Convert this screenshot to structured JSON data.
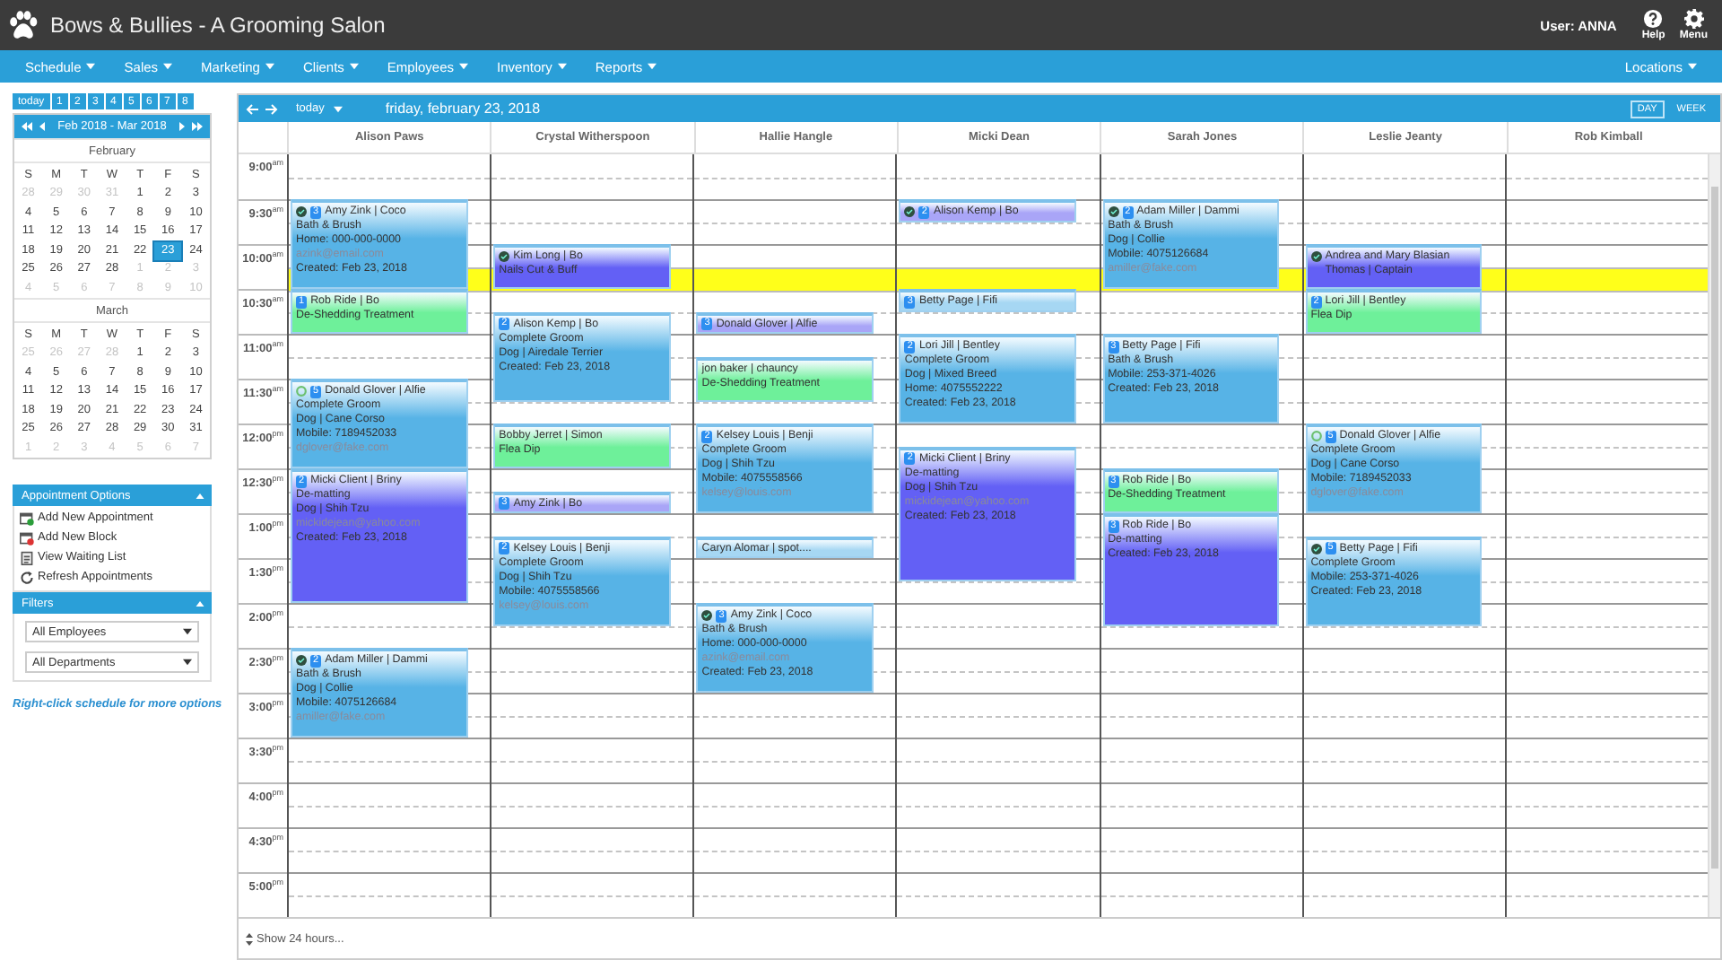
{
  "header": {
    "title": "Bows & Bullies - A Grooming Salon",
    "user": "User: ANNA",
    "actions": [
      {
        "label": "Help",
        "kind": "help"
      },
      {
        "label": "Menu",
        "kind": "settings"
      }
    ]
  },
  "nav": {
    "items": [
      "Schedule",
      "Sales",
      "Marketing",
      "Clients",
      "Employees",
      "Inventory",
      "Reports"
    ],
    "right": "Locations"
  },
  "sidebar": {
    "quick": [
      "today",
      "1",
      "2",
      "3",
      "4",
      "5",
      "6",
      "7",
      "8"
    ],
    "range": "Feb 2018 - Mar 2018",
    "months": [
      {
        "name": "February",
        "weekdays": [
          "S",
          "M",
          "T",
          "W",
          "T",
          "F",
          "S"
        ],
        "weeks": [
          [
            {
              "day": "28",
              "muted": true,
              "selected": false
            },
            {
              "day": "29",
              "muted": true,
              "selected": false
            },
            {
              "day": "30",
              "muted": true,
              "selected": false
            },
            {
              "day": "31",
              "muted": true,
              "selected": false
            },
            {
              "day": "1",
              "muted": false,
              "selected": false
            },
            {
              "day": "2",
              "muted": false,
              "selected": false
            },
            {
              "day": "3",
              "muted": false,
              "selected": false
            }
          ],
          [
            {
              "day": "4",
              "muted": false,
              "selected": false
            },
            {
              "day": "5",
              "muted": false,
              "selected": false
            },
            {
              "day": "6",
              "muted": false,
              "selected": false
            },
            {
              "day": "7",
              "muted": false,
              "selected": false
            },
            {
              "day": "8",
              "muted": false,
              "selected": false
            },
            {
              "day": "9",
              "muted": false,
              "selected": false
            },
            {
              "day": "10",
              "muted": false,
              "selected": false
            }
          ],
          [
            {
              "day": "11",
              "muted": false,
              "selected": false
            },
            {
              "day": "12",
              "muted": false,
              "selected": false
            },
            {
              "day": "13",
              "muted": false,
              "selected": false
            },
            {
              "day": "14",
              "muted": false,
              "selected": false
            },
            {
              "day": "15",
              "muted": false,
              "selected": false
            },
            {
              "day": "16",
              "muted": false,
              "selected": false
            },
            {
              "day": "17",
              "muted": false,
              "selected": false
            }
          ],
          [
            {
              "day": "18",
              "muted": false,
              "selected": false
            },
            {
              "day": "19",
              "muted": false,
              "selected": false
            },
            {
              "day": "20",
              "muted": false,
              "selected": false
            },
            {
              "day": "21",
              "muted": false,
              "selected": false
            },
            {
              "day": "22",
              "muted": false,
              "selected": false
            },
            {
              "day": "23",
              "muted": false,
              "selected": true
            },
            {
              "day": "24",
              "muted": false,
              "selected": false
            }
          ],
          [
            {
              "day": "25",
              "muted": false,
              "selected": false
            },
            {
              "day": "26",
              "muted": false,
              "selected": false
            },
            {
              "day": "27",
              "muted": false,
              "selected": false
            },
            {
              "day": "28",
              "muted": false,
              "selected": false
            },
            {
              "day": "1",
              "muted": true,
              "selected": false
            },
            {
              "day": "2",
              "muted": true,
              "selected": false
            },
            {
              "day": "3",
              "muted": true,
              "selected": false
            }
          ],
          [
            {
              "day": "4",
              "muted": true,
              "selected": false
            },
            {
              "day": "5",
              "muted": true,
              "selected": false
            },
            {
              "day": "6",
              "muted": true,
              "selected": false
            },
            {
              "day": "7",
              "muted": true,
              "selected": false
            },
            {
              "day": "8",
              "muted": true,
              "selected": false
            },
            {
              "day": "9",
              "muted": true,
              "selected": false
            },
            {
              "day": "10",
              "muted": true,
              "selected": false
            }
          ]
        ]
      },
      {
        "name": "March",
        "weekdays": [
          "S",
          "M",
          "T",
          "W",
          "T",
          "F",
          "S"
        ],
        "weeks": [
          [
            {
              "day": "25",
              "muted": true,
              "selected": false
            },
            {
              "day": "26",
              "muted": true,
              "selected": false
            },
            {
              "day": "27",
              "muted": true,
              "selected": false
            },
            {
              "day": "28",
              "muted": true,
              "selected": false
            },
            {
              "day": "1",
              "muted": false,
              "selected": false
            },
            {
              "day": "2",
              "muted": false,
              "selected": false
            },
            {
              "day": "3",
              "muted": false,
              "selected": false
            }
          ],
          [
            {
              "day": "4",
              "muted": false,
              "selected": false
            },
            {
              "day": "5",
              "muted": false,
              "selected": false
            },
            {
              "day": "6",
              "muted": false,
              "selected": false
            },
            {
              "day": "7",
              "muted": false,
              "selected": false
            },
            {
              "day": "8",
              "muted": false,
              "selected": false
            },
            {
              "day": "9",
              "muted": false,
              "selected": false
            },
            {
              "day": "10",
              "muted": false,
              "selected": false
            }
          ],
          [
            {
              "day": "11",
              "muted": false,
              "selected": false
            },
            {
              "day": "12",
              "muted": false,
              "selected": false
            },
            {
              "day": "13",
              "muted": false,
              "selected": false
            },
            {
              "day": "14",
              "muted": false,
              "selected": false
            },
            {
              "day": "15",
              "muted": false,
              "selected": false
            },
            {
              "day": "16",
              "muted": false,
              "selected": false
            },
            {
              "day": "17",
              "muted": false,
              "selected": false
            }
          ],
          [
            {
              "day": "18",
              "muted": false,
              "selected": false
            },
            {
              "day": "19",
              "muted": false,
              "selected": false
            },
            {
              "day": "20",
              "muted": false,
              "selected": false
            },
            {
              "day": "21",
              "muted": false,
              "selected": false
            },
            {
              "day": "22",
              "muted": false,
              "selected": false
            },
            {
              "day": "23",
              "muted": false,
              "selected": false
            },
            {
              "day": "24",
              "muted": false,
              "selected": false
            }
          ],
          [
            {
              "day": "25",
              "muted": false,
              "selected": false
            },
            {
              "day": "26",
              "muted": false,
              "selected": false
            },
            {
              "day": "27",
              "muted": false,
              "selected": false
            },
            {
              "day": "28",
              "muted": false,
              "selected": false
            },
            {
              "day": "29",
              "muted": false,
              "selected": false
            },
            {
              "day": "30",
              "muted": false,
              "selected": false
            },
            {
              "day": "31",
              "muted": false,
              "selected": false
            }
          ],
          [
            {
              "day": "1",
              "muted": true,
              "selected": false
            },
            {
              "day": "2",
              "muted": true,
              "selected": false
            },
            {
              "day": "3",
              "muted": true,
              "selected": false
            },
            {
              "day": "4",
              "muted": true,
              "selected": false
            },
            {
              "day": "5",
              "muted": true,
              "selected": false
            },
            {
              "day": "6",
              "muted": true,
              "selected": false
            },
            {
              "day": "7",
              "muted": true,
              "selected": false
            }
          ]
        ]
      }
    ],
    "appointment_options": {
      "title": "Appointment Options",
      "items": [
        {
          "label": "Add New Appointment",
          "kind": "add"
        },
        {
          "label": "Add New Block",
          "kind": "block"
        },
        {
          "label": "View Waiting List",
          "kind": "list"
        },
        {
          "label": "Refresh Appointments",
          "kind": "refresh"
        }
      ]
    },
    "filters": {
      "title": "Filters",
      "selects": [
        {
          "value": "All Employees"
        },
        {
          "value": "All Departments"
        }
      ]
    },
    "hint": "Right-click schedule for more options"
  },
  "schedule": {
    "today": "today",
    "date": "friday, february 23, 2018",
    "views": [
      {
        "label": "DAY",
        "selected": true
      },
      {
        "label": "WEEK",
        "selected": false
      }
    ],
    "times": [
      {
        "time": "9:00",
        "period": "am"
      },
      {
        "time": "9:30",
        "period": "am"
      },
      {
        "time": "10:00",
        "period": "am"
      },
      {
        "time": "10:30",
        "period": "am"
      },
      {
        "time": "11:00",
        "period": "am"
      },
      {
        "time": "11:30",
        "period": "am"
      },
      {
        "time": "12:00",
        "period": "pm"
      },
      {
        "time": "12:30",
        "period": "pm"
      },
      {
        "time": "1:00",
        "period": "pm"
      },
      {
        "time": "1:30",
        "period": "pm"
      },
      {
        "time": "2:00",
        "period": "pm"
      },
      {
        "time": "2:30",
        "period": "pm"
      },
      {
        "time": "3:00",
        "period": "pm"
      },
      {
        "time": "3:30",
        "period": "pm"
      },
      {
        "time": "4:00",
        "period": "pm"
      },
      {
        "time": "4:30",
        "period": "pm"
      },
      {
        "time": "5:00",
        "period": "pm"
      }
    ],
    "columns": [
      {
        "name": "Alison Paws",
        "appointments": [
          {
            "color": "#57b3e6",
            "kind": "confirmed",
            "badge": "3",
            "title": "Amy Zink | Coco",
            "lines": [
              {
                "text": "Bath & Brush",
                "kind": "text"
              },
              {
                "text": "Home: 000-000-0000",
                "kind": "text"
              },
              {
                "text": "azink@email.com",
                "kind": "email"
              },
              {
                "text": "Created: Feb 23, 2018",
                "kind": "text"
              }
            ]
          },
          {
            "color": "#6ef09a",
            "kind": "plain",
            "badge": "1",
            "title": "Rob Ride | Bo",
            "lines": [
              {
                "text": "De-Shedding Treatment",
                "kind": "text"
              }
            ]
          },
          {
            "color": "#57b3e6",
            "kind": "recurring",
            "badge": "5",
            "title": "Donald Glover | Alfie",
            "lines": [
              {
                "text": "Complete Groom",
                "kind": "text"
              },
              {
                "text": "Dog | Cane Corso",
                "kind": "text"
              },
              {
                "text": "Mobile: 7189452033",
                "kind": "text"
              },
              {
                "text": "dglover@fake.com",
                "kind": "email"
              }
            ]
          },
          {
            "color": "#6360f5",
            "kind": "plain",
            "badge": "2",
            "title": "Micki Client | Briny",
            "lines": [
              {
                "text": "De-matting",
                "kind": "text"
              },
              {
                "text": "Dog | Shih Tzu",
                "kind": "text"
              },
              {
                "text": "mickidejean@yahoo.com",
                "kind": "email"
              },
              {
                "text": "Created: Feb 23, 2018",
                "kind": "text"
              }
            ]
          },
          {
            "color": "#57b3e6",
            "kind": "confirmed",
            "badge": "2",
            "title": "Adam Miller | Dammi",
            "lines": [
              {
                "text": "Bath & Brush",
                "kind": "text"
              },
              {
                "text": "Dog | Collie",
                "kind": "text"
              },
              {
                "text": "Mobile: 4075126684",
                "kind": "text"
              },
              {
                "text": "amiller@fake.com",
                "kind": "email"
              }
            ]
          }
        ]
      },
      {
        "name": "Crystal Witherspoon",
        "appointments": [
          {
            "color": "#6360f5",
            "kind": "confirmed",
            "title": "Kim Long | Bo",
            "lines": [
              {
                "text": "Nails Cut & Buff",
                "kind": "text"
              }
            ]
          },
          {
            "color": "#57b3e6",
            "kind": "plain",
            "badge": "2",
            "title": "Alison Kemp | Bo",
            "lines": [
              {
                "text": "Complete Groom",
                "kind": "text"
              },
              {
                "text": "Dog | Airedale Terrier",
                "kind": "text"
              },
              {
                "text": "Created: Feb 23, 2018",
                "kind": "text"
              }
            ]
          },
          {
            "color": "#6ef09a",
            "kind": "plain",
            "title": "Bobby Jerret | Simon",
            "lines": [
              {
                "text": "Flea Dip",
                "kind": "text"
              }
            ]
          },
          {
            "color": "#a9a5f7",
            "kind": "plain",
            "badge": "3",
            "title": "Amy Zink | Bo"
          },
          {
            "color": "#57b3e6",
            "kind": "plain",
            "badge": "2",
            "title": "Kelsey Louis | Benji",
            "lines": [
              {
                "text": "Complete Groom",
                "kind": "text"
              },
              {
                "text": "Dog | Shih Tzu",
                "kind": "text"
              },
              {
                "text": "Mobile: 4075558566",
                "kind": "text"
              },
              {
                "text": "kelsey@louis.com",
                "kind": "email"
              }
            ]
          }
        ]
      },
      {
        "name": "Hallie Hangle",
        "appointments": [
          {
            "color": "#a9a5f7",
            "kind": "plain",
            "badge": "3",
            "title": "Donald Glover | Alfie"
          },
          {
            "color": "#6ef09a",
            "kind": "plain",
            "title": "jon baker | chauncy",
            "lines": [
              {
                "text": "De-Shedding Treatment",
                "kind": "text"
              }
            ]
          },
          {
            "color": "#57b3e6",
            "kind": "plain",
            "badge": "2",
            "title": "Kelsey Louis | Benji",
            "lines": [
              {
                "text": "Complete Groom",
                "kind": "text"
              },
              {
                "text": "Dog | Shih Tzu",
                "kind": "text"
              },
              {
                "text": "Mobile: 4075558566",
                "kind": "text"
              },
              {
                "text": "kelsey@louis.com",
                "kind": "email"
              }
            ]
          },
          {
            "color": "#a6d7f3",
            "kind": "plain",
            "title": "Caryn Alomar | spot...."
          },
          {
            "color": "#57b3e6",
            "kind": "confirmed",
            "badge": "3",
            "title": "Amy Zink | Coco",
            "lines": [
              {
                "text": "Bath & Brush",
                "kind": "text"
              },
              {
                "text": "Home: 000-000-0000",
                "kind": "text"
              },
              {
                "text": "azink@email.com",
                "kind": "email"
              },
              {
                "text": "Created: Feb 23, 2018",
                "kind": "text"
              }
            ]
          }
        ]
      },
      {
        "name": "Micki Dean",
        "appointments": [
          {
            "color": "#a9a5f7",
            "kind": "confirmed",
            "badge": "2",
            "title": "Alison Kemp | Bo"
          },
          {
            "color": "#a6d7f3",
            "kind": "plain",
            "badge": "3",
            "title": "Betty Page | Fifi"
          },
          {
            "color": "#57b3e6",
            "kind": "plain",
            "badge": "2",
            "title": "Lori Jill | Bentley",
            "lines": [
              {
                "text": "Complete Groom",
                "kind": "text"
              },
              {
                "text": "Dog | Mixed Breed",
                "kind": "text"
              },
              {
                "text": "Home: 4075552222",
                "kind": "text"
              },
              {
                "text": "Created: Feb 23, 2018",
                "kind": "text"
              }
            ]
          },
          {
            "color": "#6360f5",
            "kind": "plain",
            "badge": "2",
            "title": "Micki Client | Briny",
            "lines": [
              {
                "text": "De-matting",
                "kind": "text"
              },
              {
                "text": "Dog | Shih Tzu",
                "kind": "text"
              },
              {
                "text": "mickidejean@yahoo.com",
                "kind": "email"
              },
              {
                "text": "Created: Feb 23, 2018",
                "kind": "text"
              }
            ]
          }
        ]
      },
      {
        "name": "Sarah Jones",
        "appointments": [
          {
            "color": "#57b3e6",
            "kind": "confirmed",
            "badge": "2",
            "title": "Adam Miller | Dammi",
            "lines": [
              {
                "text": "Bath & Brush",
                "kind": "text"
              },
              {
                "text": "Dog | Collie",
                "kind": "text"
              },
              {
                "text": "Mobile: 4075126684",
                "kind": "text"
              },
              {
                "text": "amiller@fake.com",
                "kind": "email"
              }
            ]
          },
          {
            "color": "#57b3e6",
            "kind": "plain",
            "badge": "3",
            "title": "Betty Page | Fifi",
            "lines": [
              {
                "text": "Bath & Brush",
                "kind": "text"
              },
              {
                "text": "Mobile: 253-371-4026",
                "kind": "text"
              },
              {
                "text": "Created: Feb 23, 2018",
                "kind": "text"
              }
            ]
          },
          {
            "color": "#6ef09a",
            "kind": "plain",
            "badge": "3",
            "title": "Rob Ride | Bo",
            "lines": [
              {
                "text": "De-Shedding Treatment",
                "kind": "text"
              }
            ]
          },
          {
            "color": "#6360f5",
            "kind": "plain",
            "badge": "3",
            "title": "Rob Ride | Bo",
            "lines": [
              {
                "text": "De-matting",
                "kind": "text"
              },
              {
                "text": "Created: Feb 23, 2018",
                "kind": "text"
              }
            ]
          }
        ]
      },
      {
        "name": "Leslie Jeanty",
        "appointments": [
          {
            "color": "#6360f5",
            "kind": "confirmed",
            "title": "Andrea and Mary Blasian Thomas | Captain"
          },
          {
            "color": "#6ef09a",
            "kind": "plain",
            "badge": "2",
            "title": "Lori Jill | Bentley",
            "lines": [
              {
                "text": "Flea Dip",
                "kind": "text"
              }
            ]
          },
          {
            "color": "#57b3e6",
            "kind": "recurring",
            "badge": "5",
            "title": "Donald Glover | Alfie",
            "lines": [
              {
                "text": "Complete Groom",
                "kind": "text"
              },
              {
                "text": "Dog | Cane Corso",
                "kind": "text"
              },
              {
                "text": "Mobile: 7189452033",
                "kind": "text"
              },
              {
                "text": "dglover@fake.com",
                "kind": "email"
              }
            ]
          },
          {
            "color": "#57b3e6",
            "kind": "confirmed",
            "badge": "5",
            "title": "Betty Page | Fifi",
            "lines": [
              {
                "text": "Complete Groom",
                "kind": "text"
              },
              {
                "text": "Mobile: 253-371-4026",
                "kind": "text"
              },
              {
                "text": "Created: Feb 23, 2018",
                "kind": "text"
              }
            ]
          }
        ]
      },
      {
        "name": "Rob Kimball"
      }
    ],
    "footer": "Show 24 hours..."
  }
}
